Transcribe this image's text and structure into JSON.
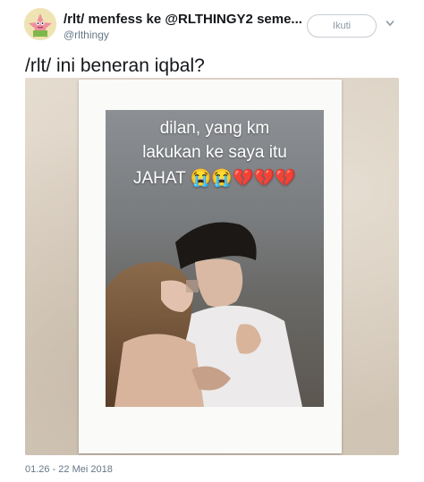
{
  "header": {
    "account_name": "/rlt/ menfess ke @RLTHINGY2 seme...",
    "handle": "@rlthingy",
    "follow_label": "Ikuti"
  },
  "tweet": {
    "text": "/rlt/ ini beneran iqbal?",
    "timestamp": "01.26 - 22 Mei 2018"
  },
  "photo": {
    "overlay_line1": "dilan, yang km",
    "overlay_line2": "lakukan ke saya itu",
    "overlay_line3": "JAHAT 😭😭💔💔💔"
  },
  "icons": {
    "avatar": "patrick-star-avatar-icon",
    "caret": "chevron-down-icon"
  },
  "colors": {
    "text": "#14171a",
    "secondary": "#657786",
    "button_border": "#c6ccd2"
  }
}
